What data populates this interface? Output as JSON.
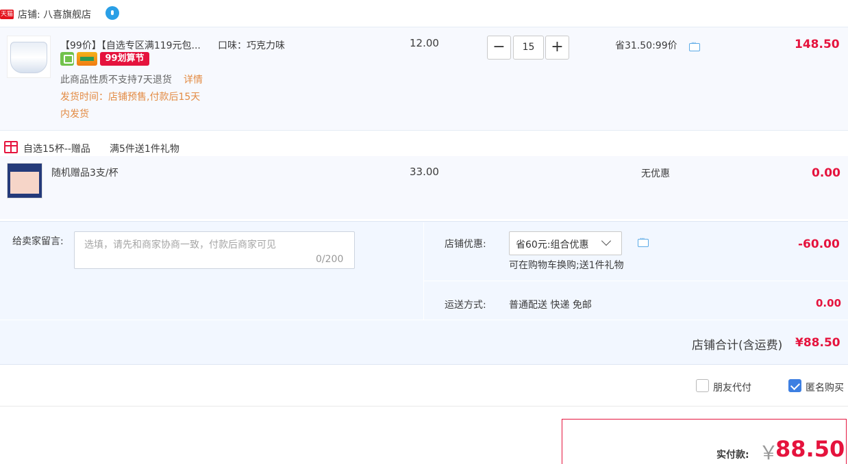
{
  "shop": {
    "badge": "天猫",
    "name": "店铺: 八喜旗舰店",
    "chat_icon": "wangwang-icon"
  },
  "item1": {
    "title": "【99价】【自选专区满119元包...",
    "flavor": "口味：巧克力味",
    "promo_badge": "99划算节",
    "no_refund": "此商品性质不支持7天退货",
    "detail_link": "详情",
    "ship_line1": "发货时间：店铺预售,付款后15天",
    "ship_line2": "内发货",
    "price": "12.00",
    "quantity": "15",
    "minus": "−",
    "plus": "+",
    "savings": "省31.50:99价",
    "total": "148.50"
  },
  "gift": {
    "title": "自选15杯--赠品",
    "rule": "满5件送1件礼物",
    "name": "随机赠品3支/杯",
    "price": "33.00",
    "discount": "无优惠",
    "total": "0.00"
  },
  "options": {
    "message_label": "给卖家留言:",
    "message_placeholder": "选填，请先和商家协商一致，付款后商家可见",
    "message_count": "0/200",
    "shop_discount_label": "店铺优惠:",
    "shop_discount_selected": "省60元:组合优惠",
    "shop_discount_note": "可在购物车换购;送1件礼物",
    "shop_discount_amount": "-60.00",
    "shipping_label": "运送方式:",
    "shipping_value": "普通配送 快递 免邮",
    "shipping_fee": "0.00",
    "shop_total_label": "店铺合计(含运费)",
    "shop_total_value": "¥88.50"
  },
  "checkout": {
    "friend_pay_label": "朋友代付",
    "friend_pay_checked": false,
    "anonymous_label": "匿名购买",
    "anonymous_checked": true,
    "pay_label": "实付款:",
    "currency": "￥",
    "pay_amount": "88.50"
  },
  "colors": {
    "accent_red": "#e5133d",
    "option_bg": "#f2f7ff",
    "row_bg": "#f7f9fe",
    "checkbox_blue": "#3d7fe2",
    "ship_orange": "#e38b43"
  }
}
